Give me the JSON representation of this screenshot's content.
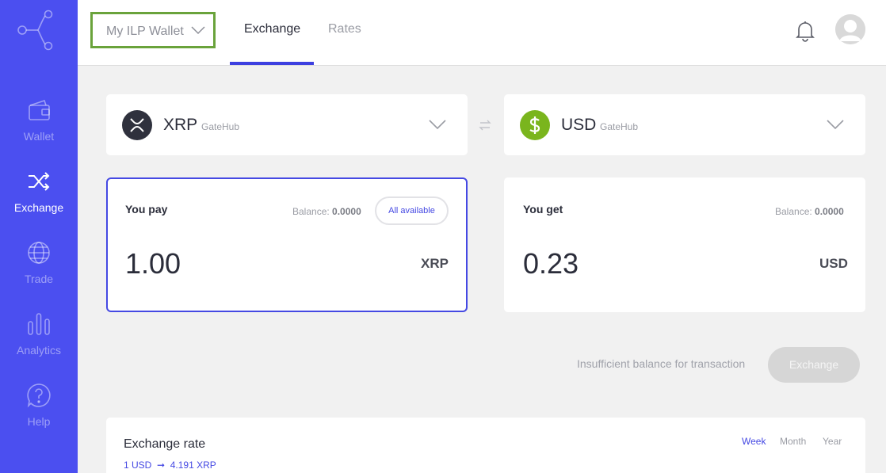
{
  "sidebar": {
    "items": [
      {
        "label": "Wallet",
        "icon": "wallet-icon"
      },
      {
        "label": "Exchange",
        "icon": "shuffle-icon",
        "active": true
      },
      {
        "label": "Trade",
        "icon": "globe-icon"
      },
      {
        "label": "Analytics",
        "icon": "bar-chart-icon"
      },
      {
        "label": "Help",
        "icon": "help-icon"
      }
    ]
  },
  "header": {
    "wallet_selector": "My ILP Wallet",
    "tabs": [
      {
        "label": "Exchange",
        "active": true
      },
      {
        "label": "Rates",
        "active": false
      }
    ]
  },
  "from_currency": {
    "code": "XRP",
    "issuer": "GateHub",
    "icon": "xrp-icon",
    "color": "#2f313d"
  },
  "to_currency": {
    "code": "USD",
    "issuer": "GateHub",
    "icon": "dollar-icon",
    "color": "#7ab51d"
  },
  "pay": {
    "title": "You pay",
    "balance_label": "Balance:",
    "balance": "0.0000",
    "all_available": "All available",
    "amount": "1.00",
    "unit": "XRP"
  },
  "get": {
    "title": "You get",
    "balance_label": "Balance:",
    "balance": "0.0000",
    "amount": "0.23",
    "unit": "USD"
  },
  "status": {
    "message": "Insufficient balance for transaction",
    "exchange_button": "Exchange"
  },
  "rate": {
    "title": "Exchange rate",
    "from": "1 USD",
    "arrow": "➞",
    "to": "4.191 XRP",
    "periods": [
      {
        "label": "Week",
        "active": true
      },
      {
        "label": "Month",
        "active": false
      },
      {
        "label": "Year",
        "active": false
      }
    ]
  },
  "colors": {
    "accent": "#4549e3",
    "sidebar": "#4b4ff0",
    "highlight": "#6aa33b"
  }
}
